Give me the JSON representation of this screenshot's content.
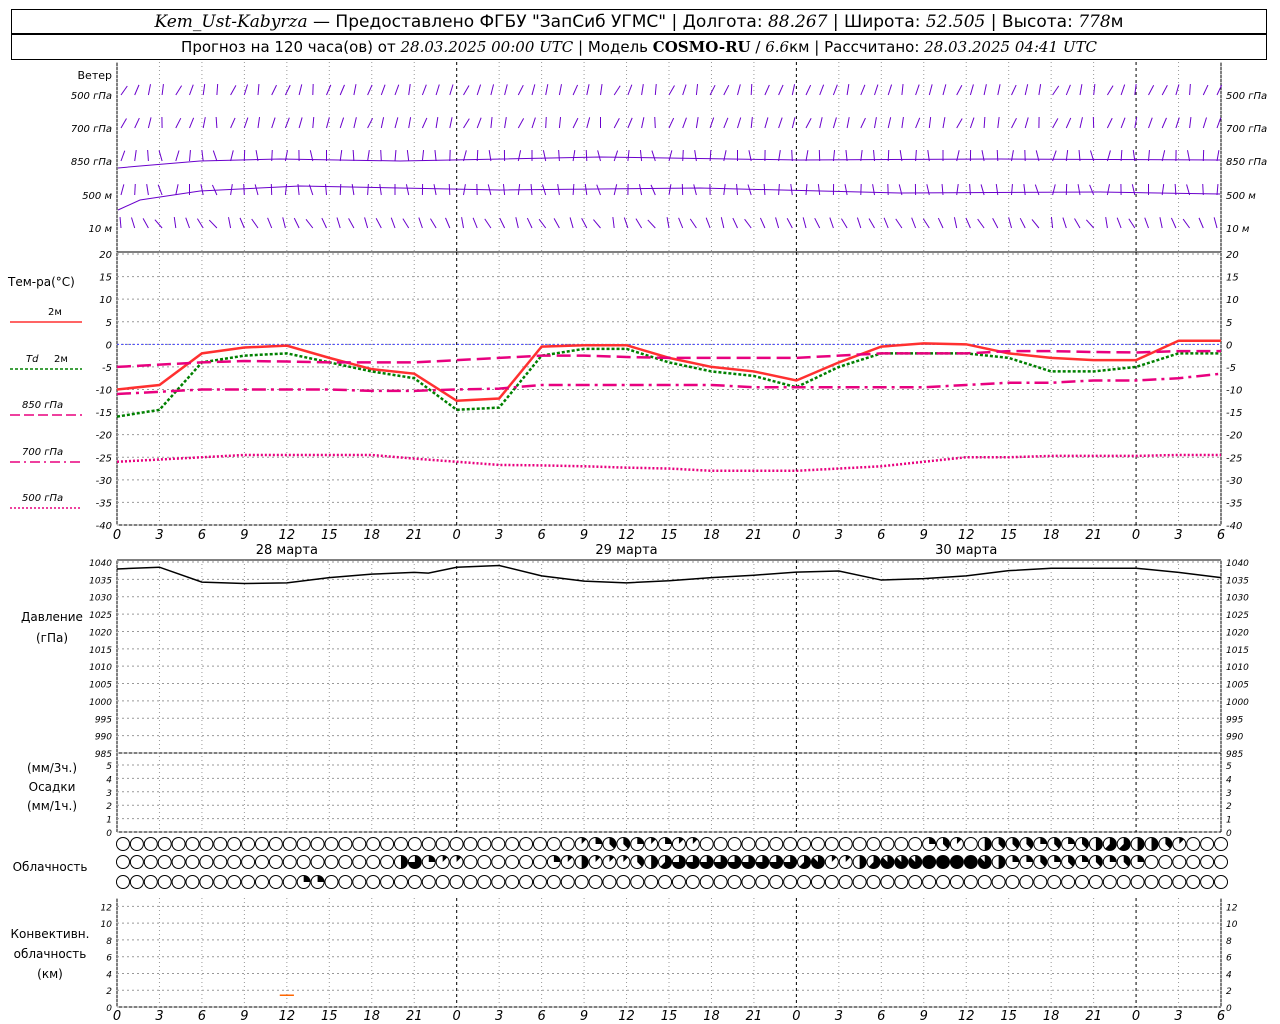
{
  "header": {
    "station": "Kem_Ust-Kabyrza",
    "provider": "Предоставлено ФГБУ \"ЗапСиб УГМС\"",
    "lon_label": "Долгота:",
    "lon": "88.267",
    "lat_label": "Широта:",
    "lat": "52.505",
    "alt_label": "Высота:",
    "alt": "778",
    "alt_unit": "м",
    "forecast_label": "Прогноз на 120 часа(ов) от",
    "forecast_start": "28.03.2025 00:00 UTC",
    "model_label": "Модель",
    "model": "COSMO-RU",
    "model_res": "6.6",
    "model_res_unit": "км",
    "computed_label": "Рассчитано:",
    "computed": "28.03.2025 04:41 UTC"
  },
  "labels": {
    "wind": "Ветер",
    "wind_levels": [
      "500 гПа",
      "700 гПа",
      "850 гПа",
      "500 м",
      "10  м"
    ],
    "temp": "Тем-ра(°C)",
    "t2m": "2м",
    "td": "Td",
    "td2m": "2м",
    "t850": "850 гПа",
    "t700": "700 гПа",
    "t500": "500 гПа",
    "pressure": "Давление",
    "pressure_unit": "(гПа)",
    "precip_unit3": "(мм/3ч.)",
    "precip": "Осадки",
    "precip_unit1": "(мм/1ч.)",
    "cloud": "Облачность",
    "conv1": "Конвективн.",
    "conv2": "облачность",
    "conv3": "(км)"
  },
  "colors": {
    "t2m": "#ff3030",
    "td": "#008000",
    "t850": "#e8007f",
    "t700": "#e8007f",
    "t500": "#e8007f",
    "wind": "#6a00cc",
    "pressure": "#000000",
    "conv": "#ff6600",
    "grid": "#999999"
  },
  "chart_data": {
    "type": "line",
    "x_ticks": [
      "0",
      "3",
      "6",
      "9",
      "12",
      "15",
      "18",
      "21",
      "0",
      "3",
      "6",
      "9",
      "12",
      "15",
      "18",
      "21",
      "0",
      "3",
      "6",
      "9",
      "12",
      "15",
      "18",
      "21",
      "0",
      "3",
      "6"
    ],
    "dates": [
      "28 марта",
      "29 марта",
      "30 марта"
    ],
    "temperature": {
      "ylim": [
        -40,
        20
      ],
      "ticks": [
        "20",
        "15",
        "10",
        "5",
        "0",
        "-5",
        "-10",
        "-15",
        "-20",
        "-25",
        "-30",
        "-35",
        "-40"
      ],
      "x_hours": [
        0,
        3,
        6,
        9,
        12,
        15,
        18,
        21,
        24,
        27,
        30,
        33,
        36,
        39,
        42,
        45,
        48,
        51,
        54,
        57,
        60,
        63,
        66,
        69,
        72,
        75,
        78
      ],
      "series": [
        {
          "name": "2м",
          "values": [
            -10,
            -9,
            -2,
            -0.7,
            -0.3,
            -3,
            -5.5,
            -6.5,
            -12.5,
            -12,
            -0.5,
            -0.2,
            -0.2,
            -3,
            -5,
            -6,
            -8,
            -4,
            -0.5,
            0.2,
            0,
            -2,
            -3,
            -3.5,
            -3.5,
            0.8,
            0.8
          ]
        },
        {
          "name": "Td 2м",
          "values": [
            -16,
            -14.5,
            -4,
            -2.5,
            -2,
            -4,
            -6,
            -7.5,
            -14.5,
            -14,
            -2.5,
            -1,
            -1,
            -4,
            -6,
            -7,
            -9.5,
            -5,
            -2,
            -2,
            -2,
            -3,
            -6,
            -6,
            -5,
            -2,
            -2
          ]
        },
        {
          "name": "850 гПа",
          "values": [
            -5,
            -4.5,
            -4,
            -3.7,
            -3.8,
            -4,
            -4,
            -4,
            -3.5,
            -3,
            -2.5,
            -2.5,
            -2.8,
            -3,
            -3,
            -3,
            -3,
            -2.5,
            -2,
            -2,
            -2,
            -1.5,
            -1.5,
            -1.7,
            -1.8,
            -1.5,
            -1.5
          ]
        },
        {
          "name": "700 гПа",
          "values": [
            -11,
            -10.5,
            -10,
            -10,
            -10,
            -10,
            -10.3,
            -10.3,
            -10,
            -9.8,
            -9,
            -9,
            -9,
            -9,
            -9,
            -9.5,
            -9.5,
            -9.5,
            -9.5,
            -9.5,
            -9,
            -8.5,
            -8.5,
            -8,
            -8,
            -7.5,
            -6.5
          ]
        },
        {
          "name": "500 гПа",
          "values": [
            -26,
            -25.5,
            -25,
            -24.5,
            -24.5,
            -24.5,
            -24.5,
            -25.3,
            -26,
            -26.7,
            -26.8,
            -27,
            -27.3,
            -27.5,
            -28,
            -28,
            -28,
            -27.5,
            -27,
            -26,
            -25,
            -25,
            -24.7,
            -24.7,
            -24.7,
            -24.5,
            -24.5
          ]
        }
      ]
    },
    "pressure": {
      "ylim": [
        985,
        1040
      ],
      "ticks": [
        "1040",
        "1035",
        "1030",
        "1025",
        "1020",
        "1015",
        "1010",
        "1005",
        "1000",
        "995",
        "990",
        "985"
      ],
      "x_hours": [
        0,
        3,
        6,
        9,
        12,
        15,
        18,
        21,
        22,
        24,
        27,
        30,
        33,
        36,
        39,
        42,
        45,
        48,
        51,
        54,
        57,
        60,
        63,
        66,
        69,
        72,
        75,
        78
      ],
      "values": [
        1038,
        1038.5,
        1034.2,
        1033.8,
        1034,
        1035.5,
        1036.5,
        1037,
        1036.8,
        1038.5,
        1039,
        1036,
        1034.5,
        1034,
        1034.6,
        1035.5,
        1036.2,
        1037.1,
        1037.4,
        1034.8,
        1035.2,
        1036,
        1037.5,
        1038.2,
        1038.2,
        1038.2,
        1037,
        1035.5
      ]
    },
    "precipitation": {
      "ylim": [
        0,
        5
      ],
      "ticks": [
        "5",
        "4",
        "3",
        "2",
        "1",
        "0"
      ],
      "values": []
    },
    "cloud_cover": {
      "rows": [
        "upper",
        "middle",
        "lower"
      ],
      "levels_0_to_8": [
        [
          0,
          0,
          0,
          0,
          0,
          0,
          0,
          0,
          0,
          0,
          0,
          0,
          0,
          0,
          0,
          0,
          0,
          0,
          0,
          0,
          0,
          0,
          0,
          0,
          0,
          0,
          0,
          0,
          0,
          0,
          0,
          0,
          0,
          0,
          0,
          0,
          0,
          0,
          0,
          0,
          0,
          0,
          0,
          0,
          0,
          0,
          0,
          0,
          0,
          0,
          0,
          0,
          0,
          0,
          0,
          0,
          0,
          0,
          0,
          0,
          0,
          0,
          0,
          0,
          0,
          0,
          0,
          0,
          0,
          0,
          0,
          0,
          0,
          0,
          0,
          0,
          0,
          0,
          0,
          0
        ],
        [
          0,
          0,
          0,
          0,
          0,
          0,
          0,
          0,
          0,
          0,
          0,
          0,
          0,
          0,
          0,
          0,
          0,
          0,
          0,
          0,
          0,
          0,
          0,
          0,
          0,
          0,
          0,
          0,
          0,
          0,
          0,
          0,
          0,
          0,
          0,
          0,
          0,
          0,
          0,
          0,
          0,
          0,
          0,
          0,
          0,
          0,
          0,
          0,
          0,
          0,
          0,
          0,
          0,
          0,
          0,
          0,
          0,
          0,
          0,
          0,
          0,
          0,
          0,
          0,
          0,
          0,
          0,
          0,
          0,
          0,
          0,
          0,
          0,
          0,
          0,
          0,
          0,
          0,
          0,
          0
        ],
        [
          0,
          0,
          0,
          0,
          0,
          0,
          0,
          0,
          0,
          0,
          0,
          0,
          0,
          0,
          0,
          0,
          0,
          0,
          0,
          0,
          0,
          0,
          0,
          0,
          0,
          0,
          0,
          0,
          0,
          0,
          0,
          0,
          0,
          0,
          0,
          0,
          0,
          0,
          0,
          0,
          0,
          0,
          0,
          0,
          0,
          0,
          0,
          0,
          0,
          0,
          0,
          0,
          0,
          0,
          0,
          0,
          0,
          0,
          0,
          0,
          0,
          0,
          0,
          0,
          0,
          0,
          0,
          0,
          0,
          0,
          0,
          0,
          0,
          0,
          0,
          0,
          0,
          0,
          0,
          0
        ]
      ],
      "notes_hours": {
        "upper": {
          "33": 1,
          "34": 2,
          "35": 3,
          "36": 3,
          "37": 2,
          "38": 1,
          "39": 2,
          "40": 1,
          "41": 1,
          "58": 2,
          "59": 3,
          "60": 1,
          "62": 4,
          "63": 3,
          "64": 3,
          "65": 3,
          "66": 2,
          "67": 3,
          "68": 2,
          "69": 3,
          "70": 4,
          "71": 5,
          "72": 5,
          "73": 4,
          "74": 4,
          "75": 3,
          "76": 1
        },
        "middle": {
          "20": 4,
          "21": 6,
          "22": 2,
          "23": 1,
          "24": 1,
          "31": 2,
          "32": 1,
          "33": 4,
          "34": 1,
          "35": 1,
          "36": 1,
          "37": 3,
          "38": 4,
          "39": 5,
          "40": 6,
          "41": 6,
          "42": 6,
          "43": 6,
          "44": 6,
          "45": 6,
          "46": 6,
          "47": 6,
          "48": 6,
          "49": 5,
          "50": 7,
          "51": 1,
          "52": 1,
          "53": 4,
          "54": 5,
          "55": 7,
          "56": 7,
          "57": 7,
          "58": 8,
          "59": 8,
          "60": 8,
          "61": 8,
          "62": 7,
          "63": 4,
          "64": 2,
          "65": 2,
          "66": 3,
          "67": 2,
          "68": 3,
          "69": 2,
          "70": 3,
          "71": 2,
          "72": 3,
          "73": 2
        },
        "lower": {
          "13": 2,
          "14": 2
        }
      }
    },
    "convective_cloud": {
      "ylim": [
        0,
        13
      ],
      "ticks": [
        "12",
        "10",
        "8",
        "6",
        "4",
        "2",
        "0"
      ],
      "segments": [
        {
          "x_hours": [
            11.5,
            12.5
          ],
          "height_km": 1.4
        }
      ]
    }
  }
}
